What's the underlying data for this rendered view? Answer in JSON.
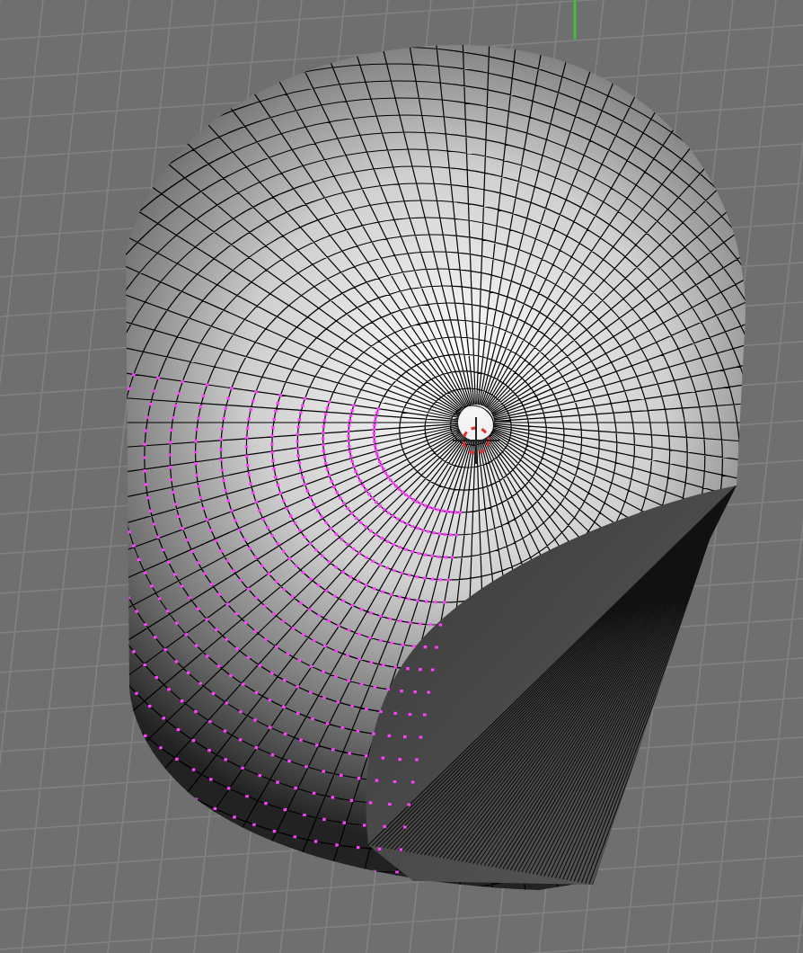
{
  "viewport": {
    "grid_visible": true,
    "mesh": {
      "wireframe": true,
      "vertices_highlighted": true
    }
  }
}
